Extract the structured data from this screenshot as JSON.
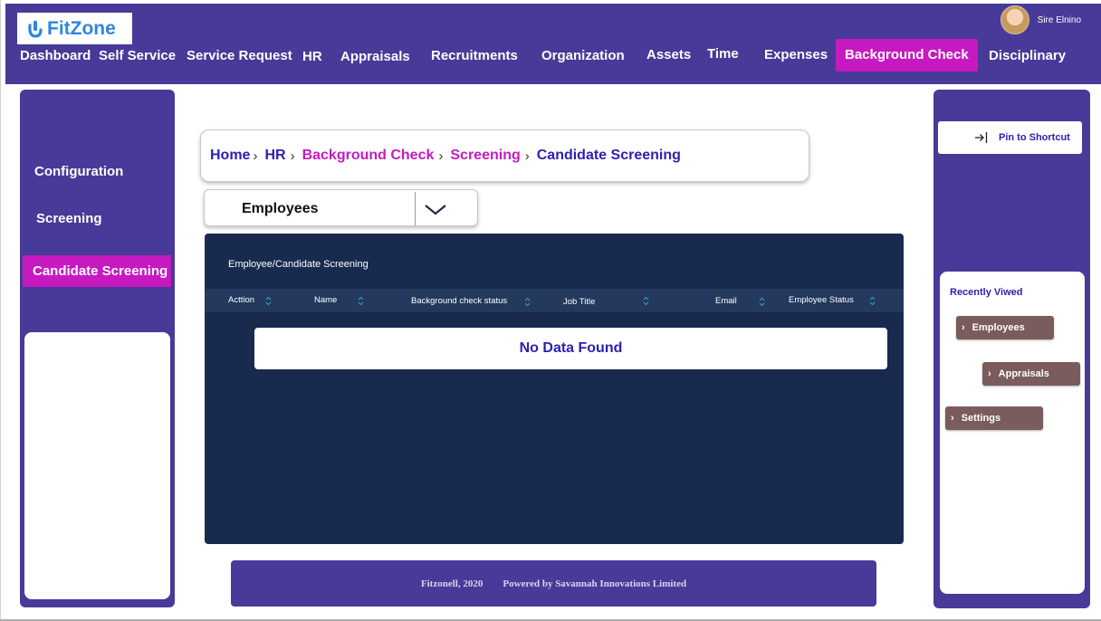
{
  "app": {
    "logo_text": "FitZone",
    "user_name": "Sire Elnino"
  },
  "nav": {
    "items": [
      {
        "label": "Dashboard"
      },
      {
        "label": "Self Service"
      },
      {
        "label": "Service Request"
      },
      {
        "label": "HR"
      },
      {
        "label": "Appraisals"
      },
      {
        "label": "Recruitments"
      },
      {
        "label": "Organization"
      },
      {
        "label": "Assets"
      },
      {
        "label": "Time"
      },
      {
        "label": "Expenses"
      },
      {
        "label": "Background Check",
        "active": true
      },
      {
        "label": "Disciplinary"
      }
    ]
  },
  "sidebar": {
    "items": [
      {
        "label": "Configuration"
      },
      {
        "label": "Screening"
      },
      {
        "label": "Candidate Screening",
        "active": true
      }
    ]
  },
  "breadcrumb": {
    "items": [
      {
        "label": "Home"
      },
      {
        "label": "HR"
      },
      {
        "label": "Background Check"
      },
      {
        "label": "Screening"
      },
      {
        "label": "Candidate Screening"
      }
    ]
  },
  "filter": {
    "selected": "Employees"
  },
  "table": {
    "title": "Employee/Candidate Screening",
    "columns": [
      "Acttion",
      "Name",
      "Background check status",
      "Job Title",
      "Email",
      "Employee Status"
    ],
    "empty_message": "No Data Found"
  },
  "footer": {
    "copyright": "Fitzonell, 2020",
    "powered_by": "Powered by Savannah Innovations Limited"
  },
  "right_sidebar": {
    "pin_label": "Pin to Shortcut",
    "recent_title": "Recently Viwed",
    "recent_items": [
      {
        "label": "Employees"
      },
      {
        "label": "Appraisals"
      },
      {
        "label": "Settings"
      }
    ]
  },
  "colors": {
    "primary_purple": "#483a98",
    "active_magenta": "#c61ac0",
    "link_blue": "#2c1fb3",
    "table_bg": "#182a4d",
    "recent_item_bg": "#7a5c5c"
  }
}
